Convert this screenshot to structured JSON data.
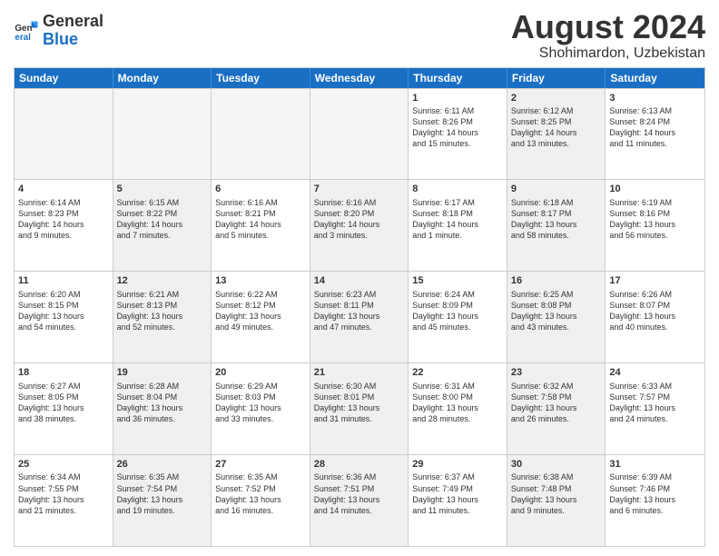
{
  "header": {
    "logo_general": "General",
    "logo_blue": "Blue",
    "month_year": "August 2024",
    "location": "Shohimardon, Uzbekistan"
  },
  "weekdays": [
    "Sunday",
    "Monday",
    "Tuesday",
    "Wednesday",
    "Thursday",
    "Friday",
    "Saturday"
  ],
  "rows": [
    [
      {
        "day": "",
        "empty": true
      },
      {
        "day": "",
        "empty": true
      },
      {
        "day": "",
        "empty": true
      },
      {
        "day": "",
        "empty": true
      },
      {
        "day": "1",
        "line1": "Sunrise: 6:11 AM",
        "line2": "Sunset: 8:26 PM",
        "line3": "Daylight: 14 hours",
        "line4": "and 15 minutes."
      },
      {
        "day": "2",
        "line1": "Sunrise: 6:12 AM",
        "line2": "Sunset: 8:25 PM",
        "line3": "Daylight: 14 hours",
        "line4": "and 13 minutes.",
        "shaded": true
      },
      {
        "day": "3",
        "line1": "Sunrise: 6:13 AM",
        "line2": "Sunset: 8:24 PM",
        "line3": "Daylight: 14 hours",
        "line4": "and 11 minutes."
      }
    ],
    [
      {
        "day": "4",
        "line1": "Sunrise: 6:14 AM",
        "line2": "Sunset: 8:23 PM",
        "line3": "Daylight: 14 hours",
        "line4": "and 9 minutes."
      },
      {
        "day": "5",
        "line1": "Sunrise: 6:15 AM",
        "line2": "Sunset: 8:22 PM",
        "line3": "Daylight: 14 hours",
        "line4": "and 7 minutes.",
        "shaded": true
      },
      {
        "day": "6",
        "line1": "Sunrise: 6:16 AM",
        "line2": "Sunset: 8:21 PM",
        "line3": "Daylight: 14 hours",
        "line4": "and 5 minutes."
      },
      {
        "day": "7",
        "line1": "Sunrise: 6:16 AM",
        "line2": "Sunset: 8:20 PM",
        "line3": "Daylight: 14 hours",
        "line4": "and 3 minutes.",
        "shaded": true
      },
      {
        "day": "8",
        "line1": "Sunrise: 6:17 AM",
        "line2": "Sunset: 8:18 PM",
        "line3": "Daylight: 14 hours",
        "line4": "and 1 minute."
      },
      {
        "day": "9",
        "line1": "Sunrise: 6:18 AM",
        "line2": "Sunset: 8:17 PM",
        "line3": "Daylight: 13 hours",
        "line4": "and 58 minutes.",
        "shaded": true
      },
      {
        "day": "10",
        "line1": "Sunrise: 6:19 AM",
        "line2": "Sunset: 8:16 PM",
        "line3": "Daylight: 13 hours",
        "line4": "and 56 minutes."
      }
    ],
    [
      {
        "day": "11",
        "line1": "Sunrise: 6:20 AM",
        "line2": "Sunset: 8:15 PM",
        "line3": "Daylight: 13 hours",
        "line4": "and 54 minutes."
      },
      {
        "day": "12",
        "line1": "Sunrise: 6:21 AM",
        "line2": "Sunset: 8:13 PM",
        "line3": "Daylight: 13 hours",
        "line4": "and 52 minutes.",
        "shaded": true
      },
      {
        "day": "13",
        "line1": "Sunrise: 6:22 AM",
        "line2": "Sunset: 8:12 PM",
        "line3": "Daylight: 13 hours",
        "line4": "and 49 minutes."
      },
      {
        "day": "14",
        "line1": "Sunrise: 6:23 AM",
        "line2": "Sunset: 8:11 PM",
        "line3": "Daylight: 13 hours",
        "line4": "and 47 minutes.",
        "shaded": true
      },
      {
        "day": "15",
        "line1": "Sunrise: 6:24 AM",
        "line2": "Sunset: 8:09 PM",
        "line3": "Daylight: 13 hours",
        "line4": "and 45 minutes."
      },
      {
        "day": "16",
        "line1": "Sunrise: 6:25 AM",
        "line2": "Sunset: 8:08 PM",
        "line3": "Daylight: 13 hours",
        "line4": "and 43 minutes.",
        "shaded": true
      },
      {
        "day": "17",
        "line1": "Sunrise: 6:26 AM",
        "line2": "Sunset: 8:07 PM",
        "line3": "Daylight: 13 hours",
        "line4": "and 40 minutes."
      }
    ],
    [
      {
        "day": "18",
        "line1": "Sunrise: 6:27 AM",
        "line2": "Sunset: 8:05 PM",
        "line3": "Daylight: 13 hours",
        "line4": "and 38 minutes."
      },
      {
        "day": "19",
        "line1": "Sunrise: 6:28 AM",
        "line2": "Sunset: 8:04 PM",
        "line3": "Daylight: 13 hours",
        "line4": "and 36 minutes.",
        "shaded": true
      },
      {
        "day": "20",
        "line1": "Sunrise: 6:29 AM",
        "line2": "Sunset: 8:03 PM",
        "line3": "Daylight: 13 hours",
        "line4": "and 33 minutes."
      },
      {
        "day": "21",
        "line1": "Sunrise: 6:30 AM",
        "line2": "Sunset: 8:01 PM",
        "line3": "Daylight: 13 hours",
        "line4": "and 31 minutes.",
        "shaded": true
      },
      {
        "day": "22",
        "line1": "Sunrise: 6:31 AM",
        "line2": "Sunset: 8:00 PM",
        "line3": "Daylight: 13 hours",
        "line4": "and 28 minutes."
      },
      {
        "day": "23",
        "line1": "Sunrise: 6:32 AM",
        "line2": "Sunset: 7:58 PM",
        "line3": "Daylight: 13 hours",
        "line4": "and 26 minutes.",
        "shaded": true
      },
      {
        "day": "24",
        "line1": "Sunrise: 6:33 AM",
        "line2": "Sunset: 7:57 PM",
        "line3": "Daylight: 13 hours",
        "line4": "and 24 minutes."
      }
    ],
    [
      {
        "day": "25",
        "line1": "Sunrise: 6:34 AM",
        "line2": "Sunset: 7:55 PM",
        "line3": "Daylight: 13 hours",
        "line4": "and 21 minutes."
      },
      {
        "day": "26",
        "line1": "Sunrise: 6:35 AM",
        "line2": "Sunset: 7:54 PM",
        "line3": "Daylight: 13 hours",
        "line4": "and 19 minutes.",
        "shaded": true
      },
      {
        "day": "27",
        "line1": "Sunrise: 6:35 AM",
        "line2": "Sunset: 7:52 PM",
        "line3": "Daylight: 13 hours",
        "line4": "and 16 minutes."
      },
      {
        "day": "28",
        "line1": "Sunrise: 6:36 AM",
        "line2": "Sunset: 7:51 PM",
        "line3": "Daylight: 13 hours",
        "line4": "and 14 minutes.",
        "shaded": true
      },
      {
        "day": "29",
        "line1": "Sunrise: 6:37 AM",
        "line2": "Sunset: 7:49 PM",
        "line3": "Daylight: 13 hours",
        "line4": "and 11 minutes."
      },
      {
        "day": "30",
        "line1": "Sunrise: 6:38 AM",
        "line2": "Sunset: 7:48 PM",
        "line3": "Daylight: 13 hours",
        "line4": "and 9 minutes.",
        "shaded": true
      },
      {
        "day": "31",
        "line1": "Sunrise: 6:39 AM",
        "line2": "Sunset: 7:46 PM",
        "line3": "Daylight: 13 hours",
        "line4": "and 6 minutes."
      }
    ]
  ]
}
